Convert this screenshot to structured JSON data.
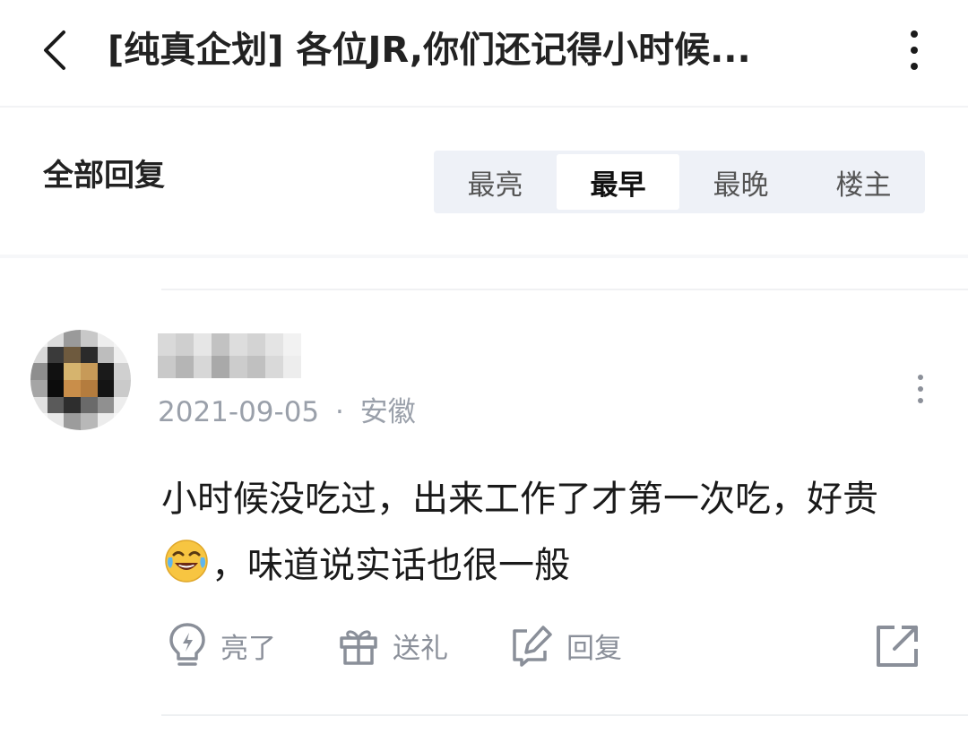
{
  "header": {
    "title": "[纯真企划] 各位JR,你们还记得小时候..."
  },
  "replies": {
    "label": "全部回复",
    "sort_tabs": [
      {
        "label": "最亮",
        "active": false
      },
      {
        "label": "最早",
        "active": true
      },
      {
        "label": "最晚",
        "active": false
      },
      {
        "label": "楼主",
        "active": false
      }
    ]
  },
  "comment": {
    "date": "2021-09-05",
    "separator": "·",
    "location": "安徽",
    "text_part1": "小时候没吃过，出来工作了才第一次吃，好贵",
    "text_part2": "，味道说实话也很一般",
    "emoji": "face-with-tears-of-joy",
    "actions": {
      "like_label": "亮了",
      "gift_label": "送礼",
      "reply_label": "回复"
    }
  },
  "colors": {
    "accent_bg": "#eef1f7",
    "meta_gray": "#9aa0aa",
    "action_gray": "#8a8f99"
  }
}
